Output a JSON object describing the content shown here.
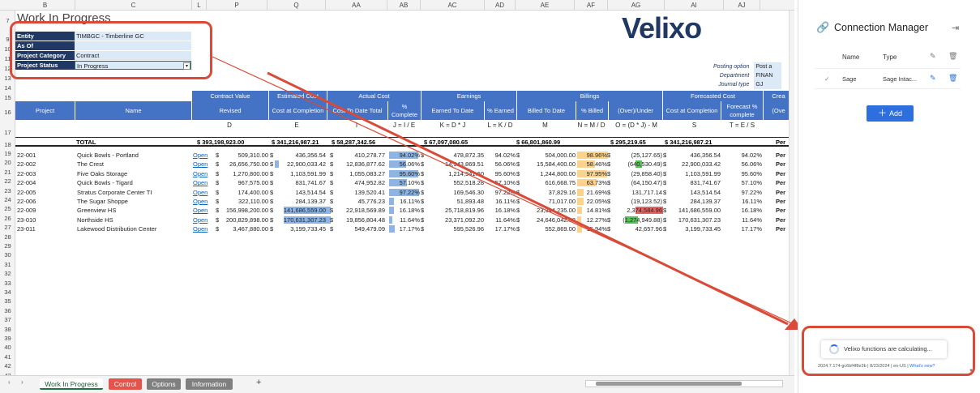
{
  "sheet": {
    "title": "Work In Progress",
    "columns": [
      "B",
      "C",
      "L",
      "P",
      "Q",
      "AA",
      "AB",
      "AC",
      "AD",
      "AE",
      "AF",
      "AG",
      "AI",
      "AJ"
    ],
    "row_numbers": [
      "7",
      "9",
      "10",
      "11",
      "12",
      "13",
      "14",
      "15",
      "16",
      "17",
      "18",
      "19",
      "20",
      "21",
      "22",
      "23",
      "24",
      "25",
      "26",
      "27",
      "28",
      "29",
      "30",
      "31",
      "32",
      "33",
      "34",
      "35",
      "36",
      "37",
      "38",
      "39",
      "40",
      "41",
      "42",
      "43",
      "44",
      "45"
    ],
    "params": [
      {
        "label": "Entity",
        "value": "TIMBGC - Timberline GC"
      },
      {
        "label": "As Of",
        "value": ""
      },
      {
        "label": "Project Category",
        "value": "Contract"
      },
      {
        "label": "Project Status",
        "value": "In Progress"
      }
    ],
    "posting": [
      {
        "label": "Posting option",
        "value": "Post a"
      },
      {
        "label": "Department",
        "value": "FINAN"
      },
      {
        "label": "Journal type",
        "value": "GJ"
      }
    ],
    "logo": "Velixo",
    "groups": [
      "Contract Value",
      "Estimated Cost",
      "Actual Cost",
      "Earnings",
      "Billings",
      "Forecasted Cost",
      "Crea"
    ],
    "subheaders": [
      "Project",
      "Name",
      "Revised",
      "Cost at Completion",
      "Cost To Date Total",
      "% Complete",
      "Earned To Date",
      "% Earned",
      "Billed To Date",
      "% Billed",
      "(Over)/Under",
      "Cost at Completion",
      "Forecast % complete",
      "(Ove"
    ],
    "formulas": [
      "D",
      "E",
      "I",
      "J = I / E",
      "K = D * J",
      "L = K / D",
      "M",
      "N = M / D",
      "O = (D * J) - M",
      "S",
      "T = E / S"
    ],
    "totals": {
      "label": "TOTAL",
      "revised": "$ 393,198,923.00",
      "est": "$ 341,216,987.21",
      "actual": "$ 58,287,342.56",
      "earned": "$ 67,097,080.65",
      "billed": "$ 66,801,860.99",
      "overunder": "$ 295,219.65",
      "fc": "$ 341,216,987.21",
      "tail": "Per"
    },
    "rows": [
      {
        "id": "22-001",
        "name": "Quick Bowls - Portland",
        "link": "Open",
        "revised": "509,310.00",
        "est": "436,356.54",
        "actual": "410,278.77",
        "pct": "94.02%",
        "earned": "478,872.35",
        "pe": "94.02%",
        "billed": "504,000.00",
        "pb": "98.96%",
        "ou": "(25,127.65)",
        "fc": "436,356.54",
        "fp": "94.02%",
        "tail": "Per"
      },
      {
        "id": "22-002",
        "name": "The Crest",
        "link": "Open",
        "revised": "26,656,750.00",
        "est": "22,900,033.42",
        "actual": "12,836,877.62",
        "pct": "56.06%",
        "earned": "14,943,869.51",
        "pe": "56.06%",
        "billed": "15,584,400.00",
        "pb": "58.46%",
        "ou": "(640,530.49)",
        "fc": "22,900,033.42",
        "fp": "56.06%",
        "tail": "Per"
      },
      {
        "id": "22-003",
        "name": "Five Oaks Storage",
        "link": "Open",
        "revised": "1,270,800.00",
        "est": "1,103,591.99",
        "actual": "1,055,083.27",
        "pct": "95.60%",
        "earned": "1,214,941.60",
        "pe": "95.60%",
        "billed": "1,244,800.00",
        "pb": "97.95%",
        "ou": "(29,858.40)",
        "fc": "1,103,591.99",
        "fp": "95.60%",
        "tail": "Per"
      },
      {
        "id": "22-004",
        "name": "Quick Bowls - Tigard",
        "link": "Open",
        "revised": "967,575.00",
        "est": "831,741.67",
        "actual": "474,952.82",
        "pct": "57.10%",
        "earned": "552,518.28",
        "pe": "57.10%",
        "billed": "616,668.75",
        "pb": "63.73%",
        "ou": "(64,150.47)",
        "fc": "831,741.67",
        "fp": "57.10%",
        "tail": "Per"
      },
      {
        "id": "22-005",
        "name": "Stratus Corporate Center TI",
        "link": "Open",
        "revised": "174,400.00",
        "est": "143,514.54",
        "actual": "139,520.41",
        "pct": "97.22%",
        "earned": "169,546.30",
        "pe": "97.22%",
        "billed": "37,829.16",
        "pb": "21.69%",
        "ou": "131,717.14",
        "fc": "143,514.54",
        "fp": "97.22%",
        "tail": "Per"
      },
      {
        "id": "22-006",
        "name": "The Sugar Shoppe",
        "link": "Open",
        "revised": "322,110.00",
        "est": "284,139.37",
        "actual": "45,776.23",
        "pct": "16.11%",
        "earned": "51,893.48",
        "pe": "16.11%",
        "billed": "71,017.00",
        "pb": "22.05%",
        "ou": "(19,123.52)",
        "fc": "284,139.37",
        "fp": "16.11%",
        "tail": "Per"
      },
      {
        "id": "22-009",
        "name": "Greenview HS",
        "link": "Open",
        "revised": "156,998,200.00",
        "est": "141,686,559.00",
        "actual": "22,918,569.89",
        "pct": "16.18%",
        "earned": "25,718,819.96",
        "pe": "16.18%",
        "billed": "23,344,235.00",
        "pb": "14.81%",
        "ou": "2,374,584.96",
        "fc": "141,686,559.00",
        "fp": "16.18%",
        "tail": "Per"
      },
      {
        "id": "23-010",
        "name": "Northside HS",
        "link": "Open",
        "revised": "200,829,898.00",
        "est": "170,631,307.23",
        "actual": "19,856,804.48",
        "pct": "11.64%",
        "earned": "23,371,092.20",
        "pe": "11.64%",
        "billed": "24,646,042.08",
        "pb": "12.27%",
        "ou": "(1,274,949.88)",
        "fc": "170,631,307.23",
        "fp": "11.64%",
        "tail": "Per"
      },
      {
        "id": "23-011",
        "name": "Lakewood Distribution Center",
        "link": "Open",
        "revised": "3,467,880.00",
        "est": "3,199,733.45",
        "actual": "549,479.09",
        "pct": "17.17%",
        "earned": "595,526.96",
        "pe": "17.17%",
        "billed": "552,869.00",
        "pb": "15.94%",
        "ou": "42,657.96",
        "fc": "3,199,733.45",
        "fp": "17.17%",
        "tail": "Per"
      }
    ],
    "tabs": [
      "Work In Progress",
      "Control",
      "Options",
      "Information"
    ],
    "add_tab": "+"
  },
  "panel": {
    "title": "Connection Manager",
    "col_name": "Name",
    "col_type": "Type",
    "conn_name": "Sage",
    "conn_type": "Sage Intac...",
    "add_label": "Add",
    "calc_text": "Velixo functions are calculating...",
    "version": "2024.7.174-gc6bf4f8e3b | 8/23/2024 | en-US |",
    "whats_new": "What's new?"
  },
  "colors": {
    "accent": "#4472c4",
    "navy": "#1f3864",
    "highlight": "#d94a38",
    "add_button": "#2e6fe0"
  }
}
